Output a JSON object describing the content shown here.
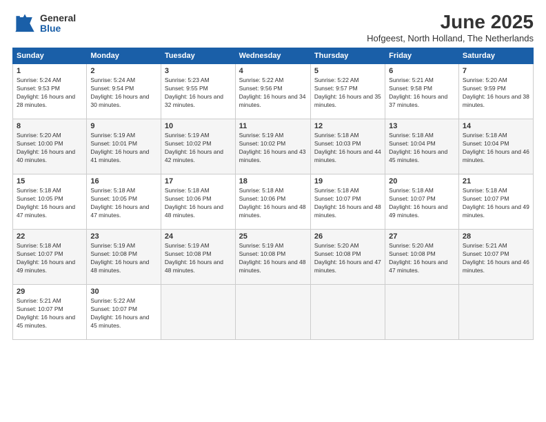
{
  "logo": {
    "general": "General",
    "blue": "Blue"
  },
  "title": "June 2025",
  "location": "Hofgeest, North Holland, The Netherlands",
  "days_header": [
    "Sunday",
    "Monday",
    "Tuesday",
    "Wednesday",
    "Thursday",
    "Friday",
    "Saturday"
  ],
  "weeks": [
    [
      {
        "day": "1",
        "sunrise": "5:24 AM",
        "sunset": "9:53 PM",
        "daylight": "16 hours and 28 minutes."
      },
      {
        "day": "2",
        "sunrise": "5:24 AM",
        "sunset": "9:54 PM",
        "daylight": "16 hours and 30 minutes."
      },
      {
        "day": "3",
        "sunrise": "5:23 AM",
        "sunset": "9:55 PM",
        "daylight": "16 hours and 32 minutes."
      },
      {
        "day": "4",
        "sunrise": "5:22 AM",
        "sunset": "9:56 PM",
        "daylight": "16 hours and 34 minutes."
      },
      {
        "day": "5",
        "sunrise": "5:22 AM",
        "sunset": "9:57 PM",
        "daylight": "16 hours and 35 minutes."
      },
      {
        "day": "6",
        "sunrise": "5:21 AM",
        "sunset": "9:58 PM",
        "daylight": "16 hours and 37 minutes."
      },
      {
        "day": "7",
        "sunrise": "5:20 AM",
        "sunset": "9:59 PM",
        "daylight": "16 hours and 38 minutes."
      }
    ],
    [
      {
        "day": "8",
        "sunrise": "5:20 AM",
        "sunset": "10:00 PM",
        "daylight": "16 hours and 40 minutes."
      },
      {
        "day": "9",
        "sunrise": "5:19 AM",
        "sunset": "10:01 PM",
        "daylight": "16 hours and 41 minutes."
      },
      {
        "day": "10",
        "sunrise": "5:19 AM",
        "sunset": "10:02 PM",
        "daylight": "16 hours and 42 minutes."
      },
      {
        "day": "11",
        "sunrise": "5:19 AM",
        "sunset": "10:02 PM",
        "daylight": "16 hours and 43 minutes."
      },
      {
        "day": "12",
        "sunrise": "5:18 AM",
        "sunset": "10:03 PM",
        "daylight": "16 hours and 44 minutes."
      },
      {
        "day": "13",
        "sunrise": "5:18 AM",
        "sunset": "10:04 PM",
        "daylight": "16 hours and 45 minutes."
      },
      {
        "day": "14",
        "sunrise": "5:18 AM",
        "sunset": "10:04 PM",
        "daylight": "16 hours and 46 minutes."
      }
    ],
    [
      {
        "day": "15",
        "sunrise": "5:18 AM",
        "sunset": "10:05 PM",
        "daylight": "16 hours and 47 minutes."
      },
      {
        "day": "16",
        "sunrise": "5:18 AM",
        "sunset": "10:05 PM",
        "daylight": "16 hours and 47 minutes."
      },
      {
        "day": "17",
        "sunrise": "5:18 AM",
        "sunset": "10:06 PM",
        "daylight": "16 hours and 48 minutes."
      },
      {
        "day": "18",
        "sunrise": "5:18 AM",
        "sunset": "10:06 PM",
        "daylight": "16 hours and 48 minutes."
      },
      {
        "day": "19",
        "sunrise": "5:18 AM",
        "sunset": "10:07 PM",
        "daylight": "16 hours and 48 minutes."
      },
      {
        "day": "20",
        "sunrise": "5:18 AM",
        "sunset": "10:07 PM",
        "daylight": "16 hours and 49 minutes."
      },
      {
        "day": "21",
        "sunrise": "5:18 AM",
        "sunset": "10:07 PM",
        "daylight": "16 hours and 49 minutes."
      }
    ],
    [
      {
        "day": "22",
        "sunrise": "5:18 AM",
        "sunset": "10:07 PM",
        "daylight": "16 hours and 49 minutes."
      },
      {
        "day": "23",
        "sunrise": "5:19 AM",
        "sunset": "10:08 PM",
        "daylight": "16 hours and 48 minutes."
      },
      {
        "day": "24",
        "sunrise": "5:19 AM",
        "sunset": "10:08 PM",
        "daylight": "16 hours and 48 minutes."
      },
      {
        "day": "25",
        "sunrise": "5:19 AM",
        "sunset": "10:08 PM",
        "daylight": "16 hours and 48 minutes."
      },
      {
        "day": "26",
        "sunrise": "5:20 AM",
        "sunset": "10:08 PM",
        "daylight": "16 hours and 47 minutes."
      },
      {
        "day": "27",
        "sunrise": "5:20 AM",
        "sunset": "10:08 PM",
        "daylight": "16 hours and 47 minutes."
      },
      {
        "day": "28",
        "sunrise": "5:21 AM",
        "sunset": "10:07 PM",
        "daylight": "16 hours and 46 minutes."
      }
    ],
    [
      {
        "day": "29",
        "sunrise": "5:21 AM",
        "sunset": "10:07 PM",
        "daylight": "16 hours and 45 minutes."
      },
      {
        "day": "30",
        "sunrise": "5:22 AM",
        "sunset": "10:07 PM",
        "daylight": "16 hours and 45 minutes."
      },
      null,
      null,
      null,
      null,
      null
    ]
  ]
}
